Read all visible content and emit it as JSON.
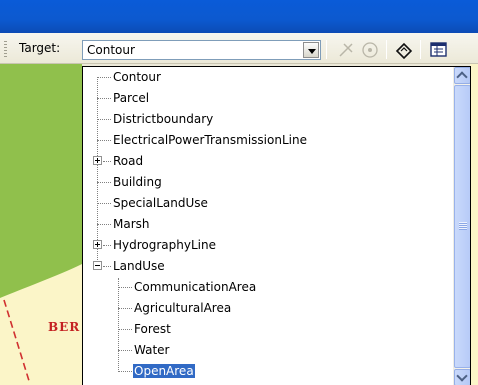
{
  "toolbar": {
    "target_label": "Target:",
    "combo_value": "Contour"
  },
  "map": {
    "label": "BER",
    "colors": {
      "green": "#90c04c",
      "cream": "#fbf5c8",
      "boundary": "#d03030"
    }
  },
  "tree": {
    "items": [
      {
        "label": "Contour",
        "level": 0
      },
      {
        "label": "Parcel",
        "level": 0
      },
      {
        "label": "Districtboundary",
        "level": 0
      },
      {
        "label": "ElectricalPowerTransmissionLine",
        "level": 0
      },
      {
        "label": "Road",
        "level": 0,
        "expander": "plus"
      },
      {
        "label": "Building",
        "level": 0
      },
      {
        "label": "SpecialLandUse",
        "level": 0
      },
      {
        "label": "Marsh",
        "level": 0
      },
      {
        "label": "HydrographyLine",
        "level": 0,
        "expander": "plus"
      },
      {
        "label": "LandUse",
        "level": 0,
        "expander": "minus"
      },
      {
        "label": "CommunicationArea",
        "level": 1
      },
      {
        "label": "AgriculturalArea",
        "level": 1
      },
      {
        "label": "Forest",
        "level": 1
      },
      {
        "label": "Water",
        "level": 1
      },
      {
        "label": "OpenArea",
        "level": 1,
        "selected": true
      }
    ],
    "selection_color": "#316ac5"
  },
  "icons": [
    "select-features-icon",
    "edit-vertices-icon",
    "sketch-tool-icon",
    "attributes-icon"
  ]
}
